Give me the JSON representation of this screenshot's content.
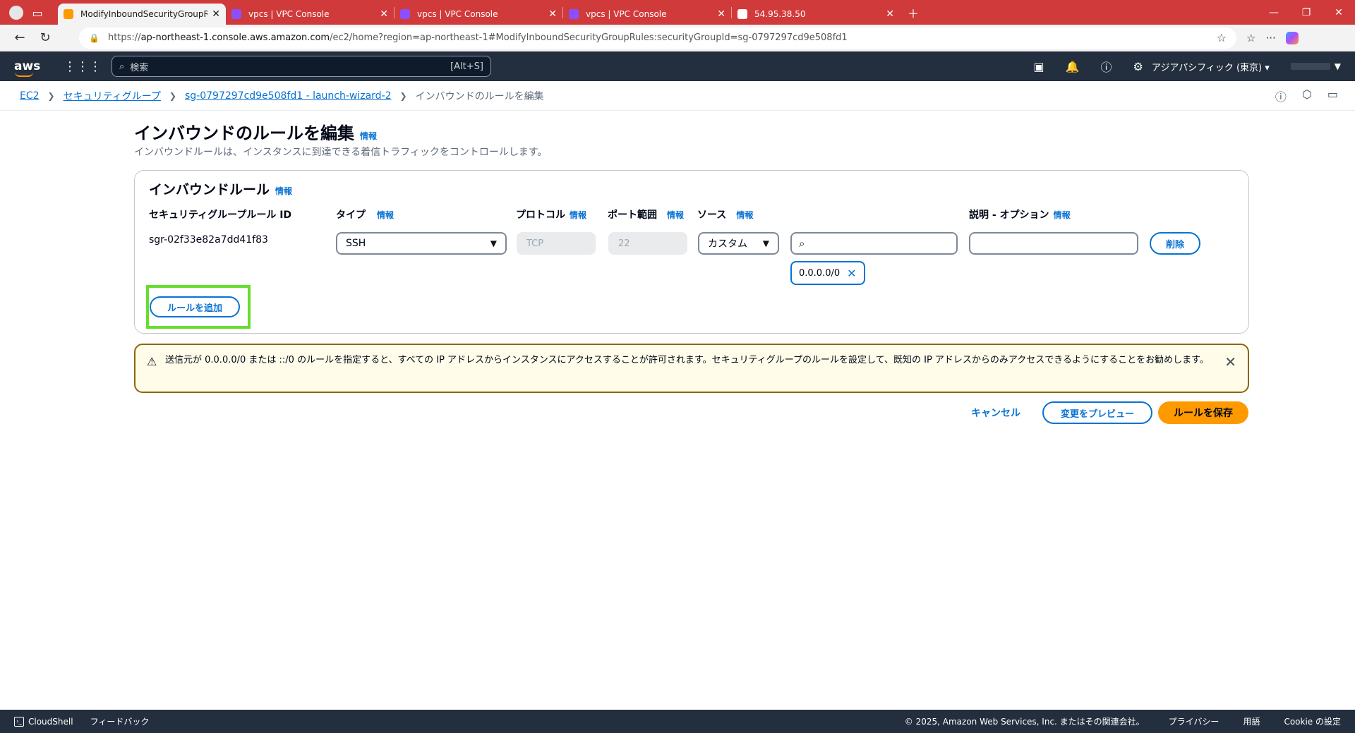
{
  "browser": {
    "tabs": [
      {
        "title": "ModifyInboundSecurityGroupRule",
        "active": true,
        "color": "#ff9900"
      },
      {
        "title": "vpcs | VPC Console",
        "active": false,
        "color": "#8c4fff"
      },
      {
        "title": "vpcs | VPC Console",
        "active": false,
        "color": "#8c4fff"
      },
      {
        "title": "vpcs | VPC Console",
        "active": false,
        "color": "#8c4fff"
      },
      {
        "title": "54.95.38.50",
        "active": false,
        "color": "#ffffff"
      }
    ],
    "url_prefix": "https://",
    "url_host": "ap-northeast-1.console.aws.amazon.com",
    "url_path": "/ec2/home?region=ap-northeast-1#ModifyInboundSecurityGroupRules:securityGroupId=sg-0797297cd9e508fd1"
  },
  "aws_nav": {
    "logo": "aws",
    "search_placeholder": "検索",
    "search_shortcut": "[Alt+S]",
    "region": "アジアパシフィック (東京) ▾"
  },
  "breadcrumb": {
    "items": [
      "EC2",
      "セキュリティグループ",
      "sg-0797297cd9e508fd1 - launch-wizard-2"
    ],
    "current": "インバウンドのルールを編集"
  },
  "page": {
    "title": "インバウンドのルールを編集",
    "info": "情報",
    "description": "インバウンドルールは、インスタンスに到達できる着信トラフィックをコントロールします。"
  },
  "rules_panel": {
    "title": "インバウンドルール",
    "info": "情報",
    "columns": {
      "rule_id": "セキュリティグループルール ID",
      "type": "タイプ",
      "protocol": "プロトコル",
      "port": "ポート範囲",
      "source": "ソース",
      "description": "説明 - オプション"
    },
    "rule": {
      "id": "sgr-02f33e82a7dd41f83",
      "type": "SSH",
      "protocol": "TCP",
      "port": "22",
      "source_mode": "カスタム",
      "source_value": "0.0.0.0/0",
      "description_value": "",
      "delete_label": "削除"
    },
    "add_rule_label": "ルールを追加"
  },
  "alert": {
    "message": "送信元が 0.0.0.0/0 または ::/0 のルールを指定すると、すべての IP アドレスからインスタンスにアクセスすることが許可されます。セキュリティグループのルールを設定して、既知の IP アドレスからのみアクセスできるようにすることをお勧めします。"
  },
  "actions": {
    "cancel": "キャンセル",
    "preview": "変更をプレビュー",
    "save": "ルールを保存"
  },
  "footer": {
    "cloudshell": "CloudShell",
    "feedback": "フィードバック",
    "copyright": "© 2025, Amazon Web Services, Inc. またはその関連会社。",
    "privacy": "プライバシー",
    "terms": "用語",
    "cookie": "Cookie の設定"
  }
}
